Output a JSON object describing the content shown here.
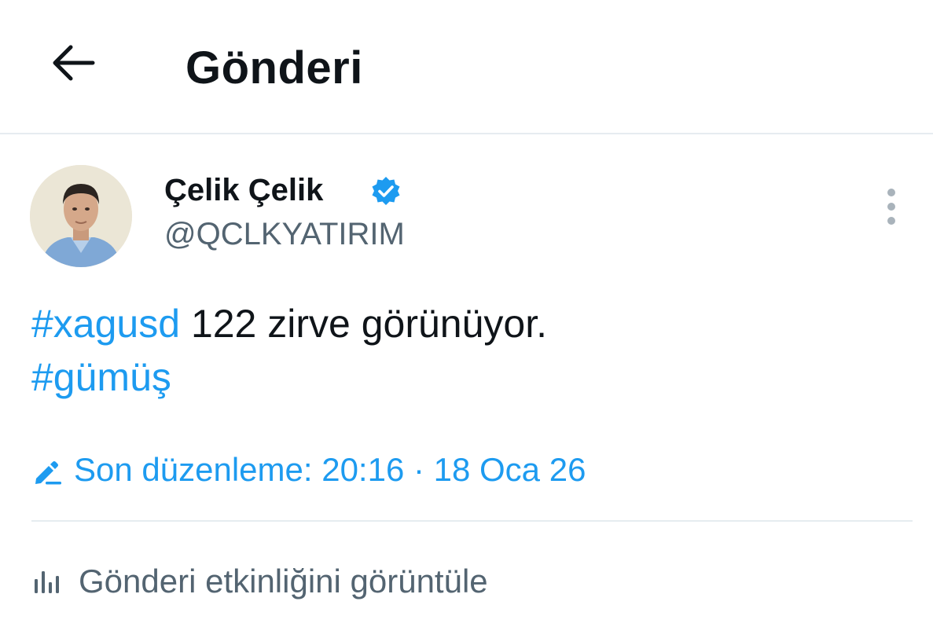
{
  "header": {
    "back_icon": "arrow-left-icon",
    "title": "Gönderi"
  },
  "tweet": {
    "author": {
      "display_name": "Çelik Çelik",
      "handle": "@QCLKYATIRIM",
      "verified_icon": "verified-badge-icon",
      "avatar": "profile-photo"
    },
    "more_icon": "more-vertical-icon",
    "text": {
      "hashtag_1": "#xagusd",
      "body": " 122 zirve görünüyor.",
      "hashtag_2": "#gümüş"
    },
    "edited": {
      "icon": "pencil-icon",
      "label": "Son düzenleme: 20:16 · 18 Oca 26"
    },
    "activity": {
      "icon": "analytics-icon",
      "label": "Gönderi etkinliğini görüntüle"
    }
  },
  "colors": {
    "accent": "#1d9bf0",
    "text_primary": "#0f1419",
    "text_secondary": "#536471",
    "divider": "#e6ecf0"
  }
}
